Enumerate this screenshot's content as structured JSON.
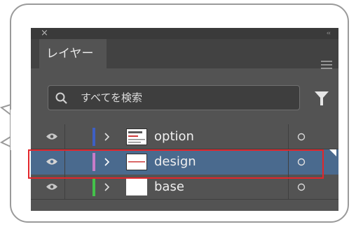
{
  "panel": {
    "close_glyph": "×",
    "collapse_glyph": "‹‹",
    "tab_label": "レイヤー"
  },
  "search": {
    "placeholder": "すべてを検索"
  },
  "layers": [
    {
      "name": "option",
      "color": "#3e5fc4",
      "selected": false
    },
    {
      "name": "design",
      "color": "#c77cc8",
      "selected": true
    },
    {
      "name": "base",
      "color": "#44c24a",
      "selected": false
    }
  ],
  "colors": {
    "panel_bg": "#535353",
    "selected_row": "#4a6a8e",
    "highlight_border": "#e2262b"
  },
  "icons": {
    "close": "close-icon",
    "collapse": "collapse-icon",
    "menu": "hamburger-menu-icon",
    "search": "search-icon",
    "filter": "filter-funnel-icon",
    "visibility": "eye-icon",
    "expand": "chevron-right-icon",
    "target": "target-circle-icon"
  }
}
